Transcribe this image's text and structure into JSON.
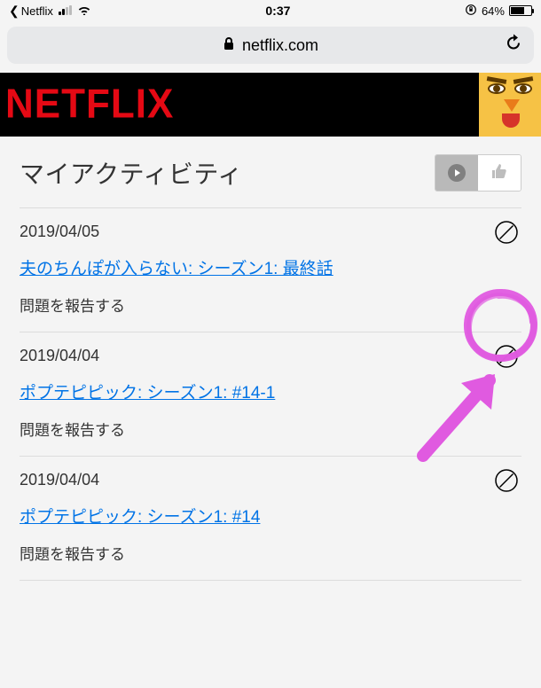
{
  "status_bar": {
    "back_app": "Netflix",
    "time": "0:37",
    "battery_pct": "64%"
  },
  "address_bar": {
    "domain": "netflix.com"
  },
  "brand": {
    "logo_text": "NETFLIX"
  },
  "page": {
    "title": "マイアクティビティ"
  },
  "activity": [
    {
      "date": "2019/04/05",
      "title": "夫のちんぽが入らない: シーズン1: 最終話",
      "report": "問題を報告する"
    },
    {
      "date": "2019/04/04",
      "title": "ポプテピピック: シーズン1: #14-1",
      "report": "問題を報告する"
    },
    {
      "date": "2019/04/04",
      "title": "ポプテピピック: シーズン1: #14",
      "report": "問題を報告する"
    }
  ]
}
